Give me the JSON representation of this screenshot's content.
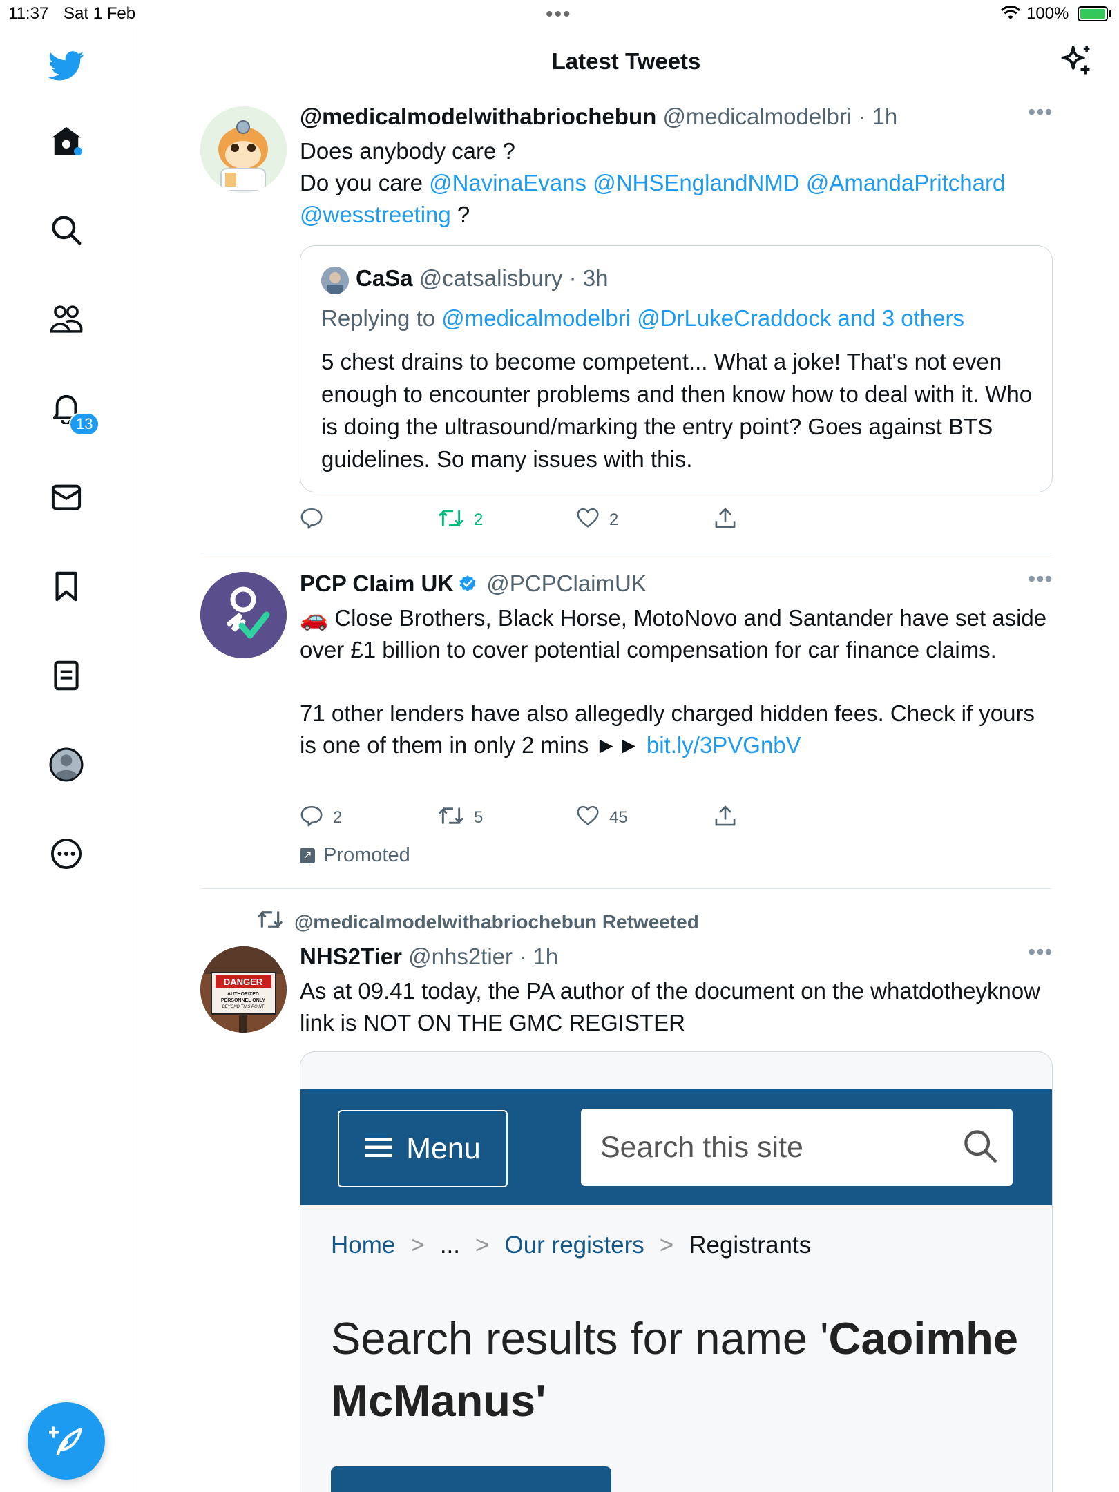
{
  "status_bar": {
    "time": "11:37",
    "date": "Sat 1 Feb",
    "battery": "100%"
  },
  "header": {
    "title": "Latest Tweets"
  },
  "sidebar": {
    "notifications_badge": "13"
  },
  "colors": {
    "accent": "#1d9bf0",
    "retweet_green": "#00ba7c",
    "gmc_blue": "#165788"
  },
  "tweets": [
    {
      "name": "@medicalmodelwithabriochebun",
      "handle": "@medicalmodelbri",
      "time": "· 1h",
      "text_1": "Does anybody care ?",
      "text_2a": "Do you care ",
      "mention_1": "@NavinaEvans",
      "mention_2": "@NHSEnglandNMD",
      "mention_3": "@AmandaPritchard",
      "mention_4": "@wesstreeting",
      "text_2b": " ?",
      "quote": {
        "name": "CaSa",
        "handle": "@catsalisbury",
        "time": "· 3h",
        "replying_prefix": "Replying to ",
        "replying_1": "@medicalmodelbri",
        "replying_2": "@DrLukeCraddock",
        "replying_3": "and 3 others",
        "text": "5 chest drains to become competent... What a joke! That's not even enough to encounter problems and then know how to deal with it. Who is doing the ultrasound/marking the entry point? Goes against BTS guidelines. So many issues with this."
      },
      "replies": "",
      "retweets": "2",
      "likes": "2"
    },
    {
      "name": "PCP Claim UK",
      "handle": "@PCPClaimUK",
      "time": "",
      "text_1": "🚗 Close Brothers, Black Horse, MotoNovo and Santander have set aside over £1 billion to cover potential compensation for car finance claims.",
      "text_2": "71 other lenders have also allegedly charged hidden fees. Check if yours is one of them in only 2 mins ►► ",
      "link": "bit.ly/3PVGnbV",
      "replies": "2",
      "retweets": "5",
      "likes": "45",
      "promoted": "Promoted"
    },
    {
      "retweeted_by": "@medicalmodelwithabriochebun Retweeted",
      "name": "NHS2Tier",
      "handle": "@nhs2tier",
      "time": "· 1h",
      "text": "As at 09.41 today, the PA author of the document on the whatdotheyknow link is NOT ON THE GMC REGISTER",
      "avatar_sign": {
        "line1": "DANGER",
        "line2": "AUTHORIZED",
        "line3": "PERSONNEL ONLY",
        "line4": "BEYOND THIS POINT"
      },
      "media": {
        "menu_label": "Menu",
        "search_placeholder": "Search this site",
        "breadcrumb": {
          "home": "Home",
          "ellipsis": "...",
          "registers": "Our registers",
          "current": "Registrants",
          "sep": ">"
        },
        "heading_prefix": "Search results for name '",
        "heading_name": "Caoimhe McManus'"
      }
    }
  ]
}
